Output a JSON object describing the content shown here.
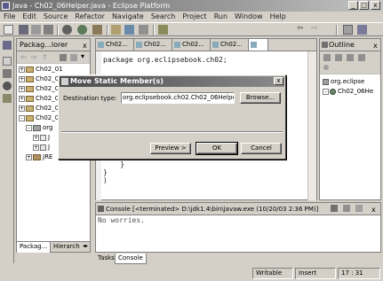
{
  "window": {
    "title": "Java - Ch02_06Helper.java - Eclipse Platform",
    "min": "_",
    "max": "□",
    "close": "x"
  },
  "menu": [
    "File",
    "Edit",
    "Source",
    "Refactor",
    "Navigate",
    "Search",
    "Project",
    "Run",
    "Window",
    "Help"
  ],
  "package_explorer": {
    "title": "Packag...lorer",
    "tree": [
      {
        "label": "Ch02_01",
        "expander": "+"
      },
      {
        "label": "Ch02_02",
        "expander": "+"
      },
      {
        "label": "Ch02_03",
        "expander": "+"
      },
      {
        "label": "Ch02_04",
        "expander": "+"
      },
      {
        "label": "Ch02_05",
        "expander": "+"
      },
      {
        "label": "Ch02_06",
        "expander": "-"
      },
      {
        "label": "org",
        "expander": "-"
      },
      {
        "label": "J",
        "expander": "+"
      },
      {
        "label": "J",
        "expander": "+"
      },
      {
        "label": "JRE",
        "expander": "+"
      }
    ],
    "tabs": [
      "Packag...",
      "Hierarch"
    ]
  },
  "editor": {
    "tabs": [
      "Ch02...",
      "Ch02...",
      "Ch02...",
      "Ch02...",
      ""
    ],
    "code_top": "package org.eclipsebook.ch02;",
    "code_bottom": [
      "    }",
      "}",
      ")"
    ]
  },
  "outline": {
    "title": "Outline",
    "items": [
      "org.eclipse",
      "Ch02_06He"
    ]
  },
  "dialog": {
    "title": "Move Static Member(s)",
    "label": "Destination type:",
    "value": "org.eclipsebook.ch02.Ch02_06Helper",
    "browse": "Browse...",
    "preview": "Preview >",
    "ok": "OK",
    "cancel": "Cancel"
  },
  "console": {
    "title": "Console [<terminated> D:\\jdk1.4\\bin\\javaw.exe (10/20/03 2:36 PM)]",
    "output": "No worries."
  },
  "bottom_tabs": [
    "Tasks",
    "Console"
  ],
  "status": {
    "writable": "Writable",
    "insert": "Insert",
    "position": "17 : 31"
  }
}
